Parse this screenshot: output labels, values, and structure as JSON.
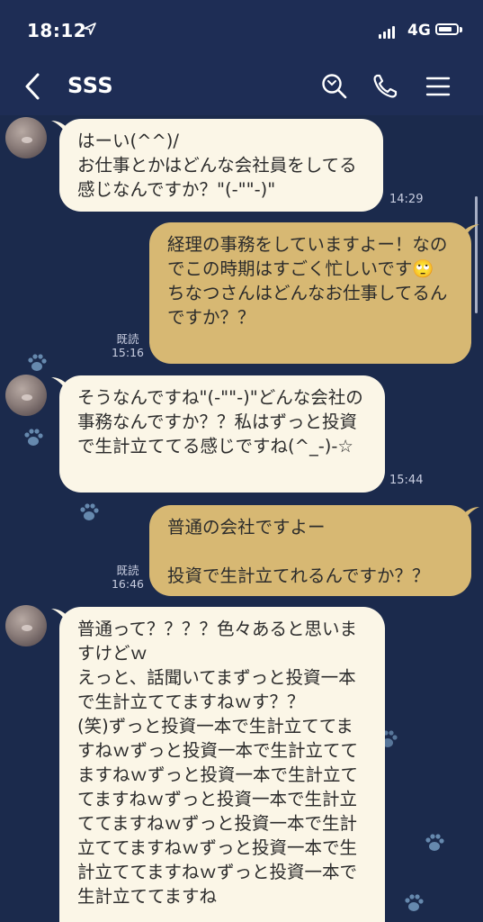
{
  "status": {
    "time": "18:12",
    "network": "4G",
    "battery_level": 0.8
  },
  "header": {
    "title": "SSS"
  },
  "messages": [
    {
      "id": 1,
      "direction": "incoming",
      "text": "はーい(^^)/\nお仕事とかはどんな会社員をしてる感じなんですか？\"(-\"\"-)\"",
      "time": "14:29"
    },
    {
      "id": 2,
      "direction": "outgoing",
      "text": "経理の事務をしていますよー！なのでこの時期はすごく忙しいです🙄\nちなつさんはどんなお仕事してるんですか？？",
      "read": "既読",
      "time": "15:16"
    },
    {
      "id": 3,
      "direction": "incoming",
      "text": "そうなんですね\"(-\"\"-)\"どんな会社の事務なんですか？？私はずっと投資で生計立ててる感じですね(^_-)-☆",
      "time": "15:44"
    },
    {
      "id": 4,
      "direction": "outgoing",
      "text": "普通の会社ですよー\n\n投資で生計立てれるんですか？？",
      "read": "既読",
      "time": "16:46"
    },
    {
      "id": 5,
      "direction": "incoming",
      "text": "普通って？？？？色々あると思いますけどｗ\nえっと、話聞いてまずっと投資一本で生計立ててますねｗす？？\n(笑)ずっと投資一本で生計立ててますねｗずっと投資一本で生計立ててますねｗずっと投資一本で生計立ててますねｗずっと投資一本で生計立ててますねｗずっと投資一本で生計立ててますねｗずっと投資一本で生計立ててますねｗずっと投資一本で生計立ててますね"
    }
  ],
  "colors": {
    "nav_bg": "#1e2d55",
    "chat_bg": "#1b2a4c",
    "incoming_bubble": "#fbf6e7",
    "outgoing_bubble": "#d7b873"
  },
  "icons": [
    "back-icon",
    "search-icon",
    "phone-icon",
    "menu-icon",
    "location-arrow-icon"
  ]
}
